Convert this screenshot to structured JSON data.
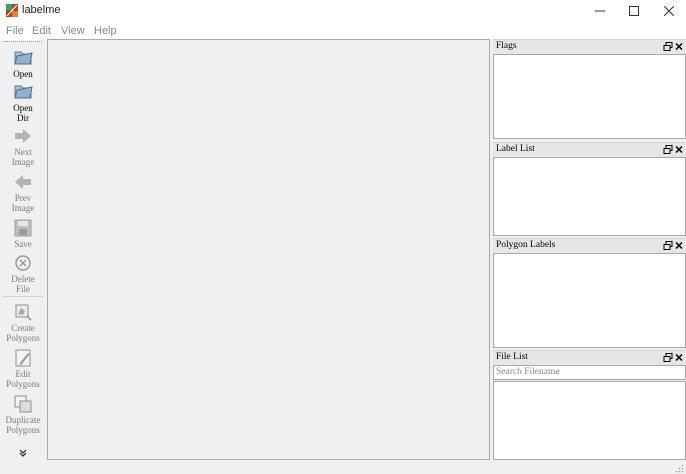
{
  "window": {
    "title": "labelme",
    "controls": [
      "minimize-icon",
      "maximize-icon",
      "close-icon"
    ]
  },
  "menu": [
    "File",
    "Edit",
    "View",
    "Help"
  ],
  "toolbar": [
    {
      "label": "Open",
      "icon": "open-folder-icon",
      "enabled": true
    },
    {
      "label": "Open\nDir",
      "icon": "open-dir-icon",
      "enabled": true
    },
    {
      "label": "Next\nImage",
      "icon": "arrow-right-icon",
      "enabled": false
    },
    {
      "label": "Prev\nImage",
      "icon": "arrow-left-icon",
      "enabled": false
    },
    {
      "label": "Save",
      "icon": "save-icon",
      "enabled": false
    },
    {
      "label": "Delete\nFile",
      "icon": "delete-icon",
      "enabled": false
    },
    {
      "label": "Create\nPolygons",
      "icon": "create-polygon-icon",
      "enabled": false
    },
    {
      "label": "Edit\nPolygons",
      "icon": "edit-polygon-icon",
      "enabled": false
    },
    {
      "label": "Duplicate\nPolygons",
      "icon": "duplicate-icon",
      "enabled": false
    }
  ],
  "toolbar_more": "»",
  "docks": [
    {
      "title": "Flags"
    },
    {
      "title": "Label List"
    },
    {
      "title": "Polygon Labels"
    },
    {
      "title": "File List"
    }
  ],
  "file_search": {
    "placeholder": "Search Filename",
    "value": ""
  },
  "colors": {
    "background": "#f0f0f0",
    "dock_header": "#e6e6e6",
    "border": "#a9a9a9",
    "disabled_text": "#7a7a7a",
    "icon_blue": "#6f8fb0"
  }
}
